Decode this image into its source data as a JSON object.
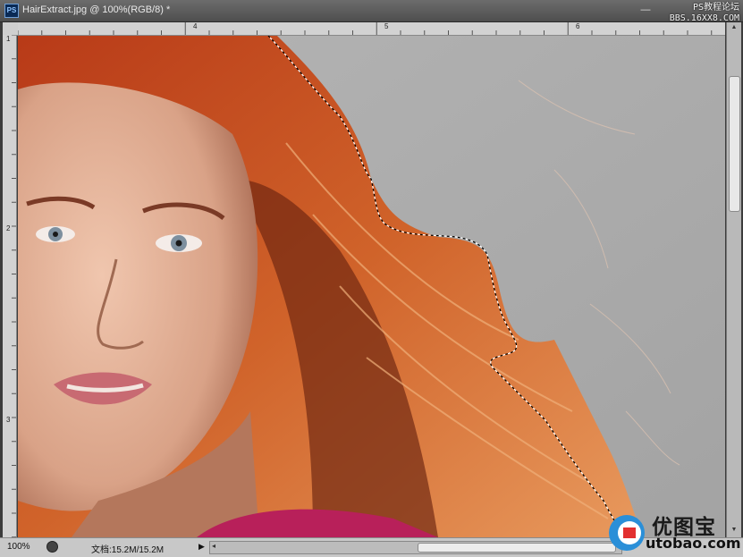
{
  "app": {
    "logo_text": "PS"
  },
  "document": {
    "title": "HairExtract.jpg @ 100%(RGB/8) *"
  },
  "window_controls": {
    "minimize": "—",
    "close": "✕"
  },
  "watermark_top": {
    "line1": "PS教程论坛",
    "line2": "BBS.16XX8.COM"
  },
  "rulers": {
    "top_labels": [
      "4",
      "5",
      "6"
    ],
    "left_labels": [
      "1",
      "2",
      "3"
    ]
  },
  "status": {
    "zoom": "100%",
    "doc_size": "文档:15.2M/15.2M",
    "menu_arrow": "▶",
    "scroll_left_arrow": "◂"
  },
  "watermark_bottom": {
    "brand": "优图宝",
    "url": "utobao.com"
  },
  "colors": {
    "background_gray": "#aeaeae",
    "hair": "#c2501f",
    "skin": "#e2b29a",
    "shirt": "#b8205a",
    "lips": "#c86a72"
  }
}
